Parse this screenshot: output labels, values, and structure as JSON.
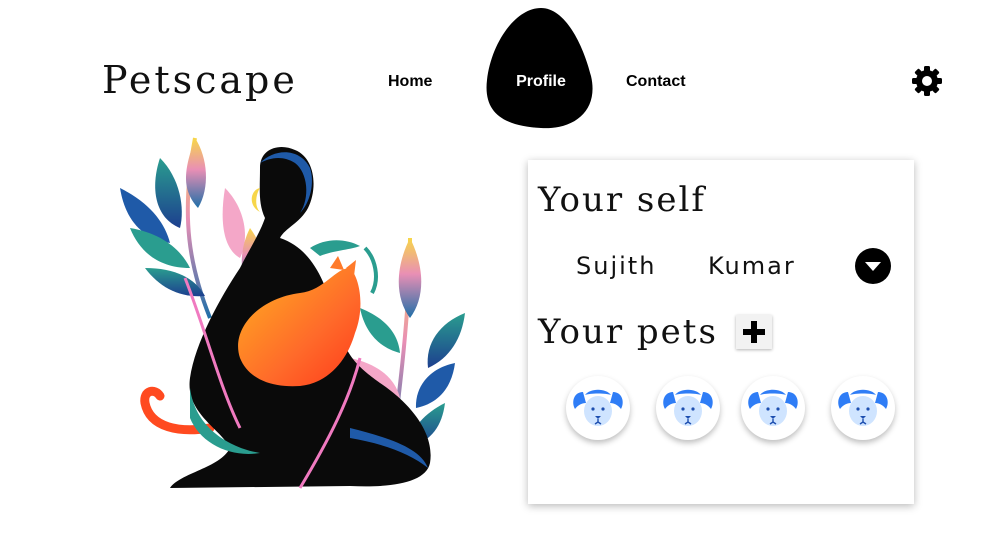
{
  "brand": {
    "logo_text": "Petscape"
  },
  "nav": {
    "home_label": "Home",
    "profile_label": "Profile",
    "contact_label": "Contact",
    "settings_icon": "gear-icon"
  },
  "profile_card": {
    "self_heading": "Your self",
    "first_name": "Sujith",
    "last_name": "Kumar",
    "dropdown_icon": "chevron-down-icon",
    "pets_heading": "Your pets",
    "add_icon": "plus-icon",
    "pets": [
      {
        "icon": "dog-icon"
      },
      {
        "icon": "dog-icon"
      },
      {
        "icon": "dog-icon"
      },
      {
        "icon": "dog-icon"
      }
    ]
  },
  "colors": {
    "accent": "#000000",
    "background": "#ffffff",
    "pet_icon_blue": "#2f7df6",
    "pet_icon_light": "#cfe4ff"
  }
}
